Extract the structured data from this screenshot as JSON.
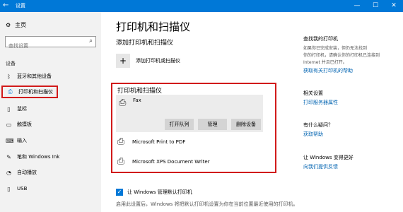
{
  "titlebar": {
    "title": "设置",
    "back": "←",
    "minimize": "—",
    "maximize": "☐",
    "close": "✕"
  },
  "sidebar": {
    "home": "主页",
    "search_placeholder": "查找设置",
    "section": "设备",
    "items": [
      {
        "label": "蓝牙和其他设备",
        "icon": "bluetooth-icon"
      },
      {
        "label": "打印机和扫描仪",
        "icon": "printer-icon"
      },
      {
        "label": "鼠标",
        "icon": "mouse-icon"
      },
      {
        "label": "触摸板",
        "icon": "touchpad-icon"
      },
      {
        "label": "输入",
        "icon": "keyboard-icon"
      },
      {
        "label": "笔和 Windows Ink",
        "icon": "pen-icon"
      },
      {
        "label": "自动播放",
        "icon": "autoplay-icon"
      },
      {
        "label": "USB",
        "icon": "usb-icon"
      }
    ]
  },
  "main": {
    "title": "打印机和扫描仪",
    "add_section": "添加打印机和扫描仪",
    "add_label": "添加打印机或扫描仪",
    "printers_title": "打印机和扫描仪",
    "fax": {
      "name": "Fax",
      "buttons": [
        "打开队列",
        "管理",
        "删除设备"
      ]
    },
    "printers": [
      "Microsoft Print to PDF",
      "Microsoft XPS Document Writer"
    ],
    "checkbox_label": "让 Windows 管理默认打印机",
    "checkbox_desc": "启用此设置后，Windows 将把默认打印机设置为你在当前位置最近使用的打印机。"
  },
  "right": {
    "s1_title": "查找我的打印机",
    "s1_text": [
      "如果你已完成安装，但仍无法找到",
      "你的打印机，请确认你的打印机已连接到",
      "Internet 并且已打开。"
    ],
    "s1_link": "获取有关打印机的帮助",
    "s2_title": "相关设置",
    "s2_link": "打印服务器属性",
    "s3_title": "有什么疑问？",
    "s3_link": "获取帮助",
    "s4_title": "让 Windows 变得更好",
    "s4_link": "向我们提供反馈"
  },
  "colors": {
    "accent": "#0078d7",
    "highlight": "#d11a1a",
    "link": "#0063b1"
  }
}
